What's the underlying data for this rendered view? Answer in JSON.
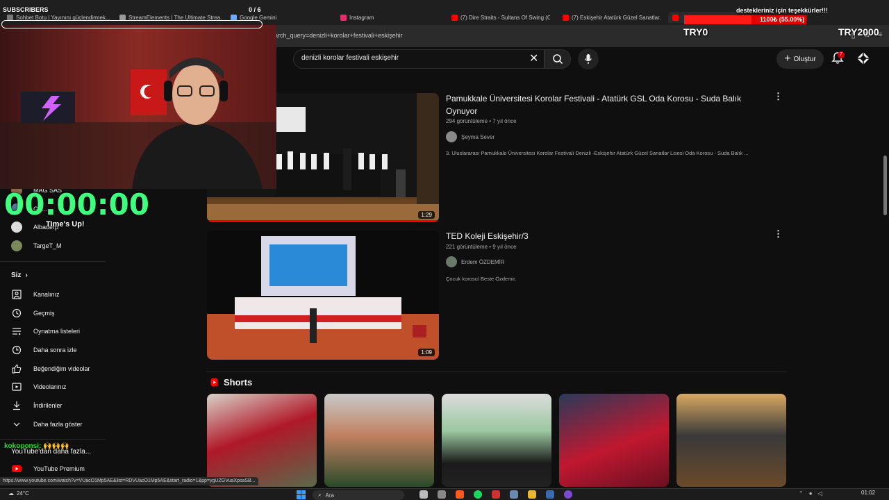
{
  "browser": {
    "tabs": [
      {
        "label": "Sohbet Botu | Yayınını güçlendirmek...",
        "color": "#7a7a7a"
      },
      {
        "label": "StreamElements | The Ultimate Strea...",
        "color": "#9a9a9a"
      },
      {
        "label": "Google Gemini",
        "color": "#6fa8ff"
      },
      {
        "label": "Instagram",
        "color": "#e1306c"
      },
      {
        "label": "(7) Dire Straits - Sultans Of Swing (C...",
        "color": "#ff0000"
      },
      {
        "label": "(7) Eskişehir Atatürk Güzel Sanatlar...",
        "color": "#ff0000"
      }
    ],
    "address": "earch_query=denizli+korolar+festivali+eskişehir",
    "status_url": "https://www.youtube.com/watch?v=VUacO1Mp5AE&list=RDVUacO1Mp5AE&start_radio=1&pp=ygUZGVuaXpsaSB..."
  },
  "header": {
    "search_query": "denizli korolar festivali eskişehir",
    "create_label": "Oluştur",
    "notification_count": "7"
  },
  "results": [
    {
      "title": "Pamukkale Üniversitesi Korolar Festivali - Atatürk GSL Oda Korosu - Suda Balık Oynuyor",
      "meta": "294 görüntüleme • 7 yıl önce",
      "channel": "Şeyma Sever",
      "description": "3. Uluslararası Pamukkale Üniversitesi Korolar Festivali Denizli -Eskişehir Atatürk Güzel Sanatlar Lisesi Oda Korosu - Suda Balık ...",
      "duration": "1:29"
    },
    {
      "title": "TED Koleji Eskişehir/3",
      "meta": "221 görüntüleme • 9 yıl önce",
      "channel": "Erdem ÖZDEMİR",
      "description": "Çocuk korosu/ Beste Özdemir.",
      "duration": "1:09"
    }
  ],
  "shorts": {
    "title": "Shorts"
  },
  "sidebar": {
    "subscriptions": [
      {
        "label": "MAG SAS",
        "color": "#8a6a4a"
      },
      {
        "label": "Ge...",
        "color": "#5a7a9a"
      },
      {
        "label": "Albaderp",
        "color": "#dddddd"
      },
      {
        "label": "TargeT_M",
        "color": "#7a8a5a"
      }
    ],
    "you_heading": "Siz",
    "items": [
      {
        "label": "Kanalınız",
        "icon": "channel-icon"
      },
      {
        "label": "Geçmiş",
        "icon": "history-icon"
      },
      {
        "label": "Oynatma listeleri",
        "icon": "playlist-icon"
      },
      {
        "label": "Daha sonra izle",
        "icon": "watch-later-icon"
      },
      {
        "label": "Beğendiğim videolar",
        "icon": "thumbs-up-icon"
      },
      {
        "label": "Videolarınız",
        "icon": "your-videos-icon"
      },
      {
        "label": "İndirilenler",
        "icon": "download-icon"
      },
      {
        "label": "Daha fazla göster",
        "icon": "chevron-down-icon"
      }
    ],
    "more_from_youtube": "YouTube'dan daha fazla...",
    "premium": "YouTube Premium"
  },
  "overlays": {
    "subscribers_label": "SUBSCRIBERS",
    "subscribers_count": "0 / 6",
    "subscribers_progress": 0.0,
    "thanks_text": "destekleriniz için teşekkürler!!!",
    "donation_text": "1100₺ (55.00%)",
    "donation_progress": 0.55,
    "try_current": "TRY0",
    "try_goal": "TRY2000",
    "timer": "00:00:00",
    "timer_status": "Time's Up!",
    "chat_user": "kokoponsi:",
    "chat_emotes": "🙌🙌🙌"
  },
  "taskbar": {
    "temperature": "24°C",
    "search_placeholder": "Ara",
    "time": "01:02"
  },
  "colors": {
    "background": "#0f0f0f",
    "accent_red": "#ff0000",
    "timer_green": "#3fff7f"
  }
}
